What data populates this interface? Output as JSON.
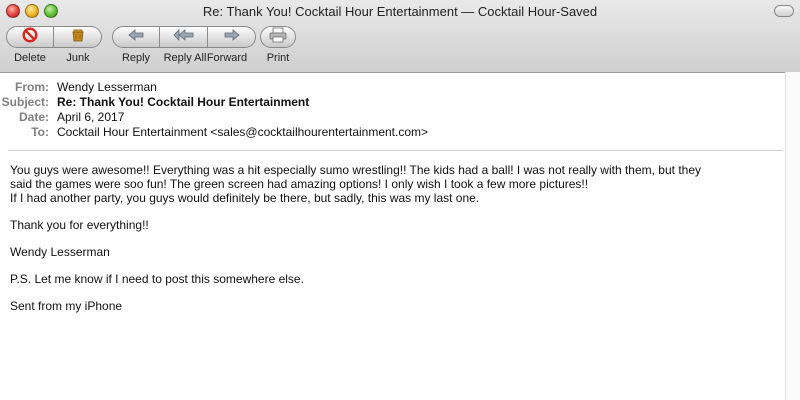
{
  "window": {
    "title": "Re: Thank You! Cocktail Hour Entertainment — Cocktail Hour-Saved"
  },
  "toolbar": {
    "delete_label": "Delete",
    "junk_label": "Junk",
    "reply_label": "Reply",
    "reply_all_label": "Reply All",
    "forward_label": "Forward",
    "print_label": "Print",
    "icons": [
      "delete-icon",
      "junk-icon",
      "reply-icon",
      "reply-all-icon",
      "forward-icon",
      "print-icon"
    ]
  },
  "headers": {
    "from_label": "From:",
    "from_value": "Wendy Lesserman",
    "subject_label": "Subject:",
    "subject_value": "Re: Thank You! Cocktail Hour Entertainment",
    "date_label": "Date:",
    "date_value": "April 6, 2017",
    "to_label": "To:",
    "to_value": "Cocktail Hour Entertainment <sales@cocktailhourentertainment.com>"
  },
  "message": {
    "para1_line1": "You guys were awesome!! Everything was a hit especially sumo wrestling!!  The kids had a ball! I was not really with them, but they",
    "para1_line2": "said the games were soo fun! The green screen had amazing options! I only wish I took a few more pictures!!",
    "para1_line3": "If I had another party, you guys would definitely be there, but sadly, this was my last one.",
    "para2": "Thank you for everything!!",
    "para3": "Wendy Lesserman",
    "para4": "P.S. Let me know if I need to post this somewhere else.",
    "para5": "Sent from my iPhone"
  },
  "colors": {
    "header_label": "#808080",
    "delete_icon": "#d9241b",
    "junk_icon": "#c98a1e"
  }
}
